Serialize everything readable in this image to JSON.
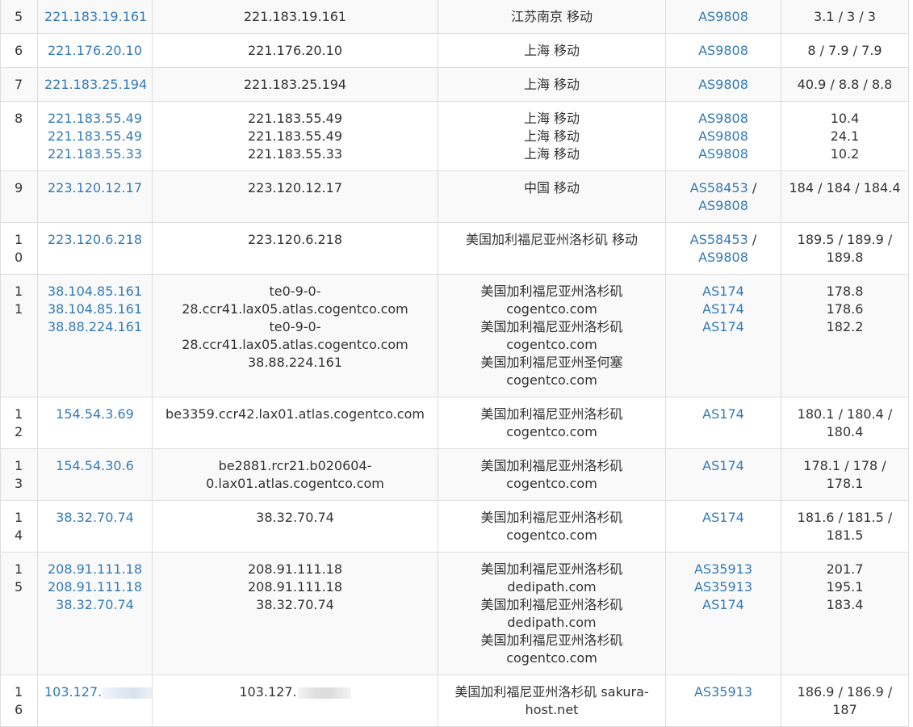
{
  "rows": [
    {
      "hop": "5",
      "ips": [
        "221.183.19.161"
      ],
      "hosts": [
        "221.183.19.161"
      ],
      "locs": [
        "江苏南京 移动"
      ],
      "as": [
        "AS9808"
      ],
      "rtt": "3.1 / 3 / 3"
    },
    {
      "hop": "6",
      "ips": [
        "221.176.20.10"
      ],
      "hosts": [
        "221.176.20.10"
      ],
      "locs": [
        "上海 移动"
      ],
      "as": [
        "AS9808"
      ],
      "rtt": "8 / 7.9 / 7.9"
    },
    {
      "hop": "7",
      "ips": [
        "221.183.25.194"
      ],
      "hosts": [
        "221.183.25.194"
      ],
      "locs": [
        "上海 移动"
      ],
      "as": [
        "AS9808"
      ],
      "rtt": "40.9 / 8.8 / 8.8"
    },
    {
      "hop": "8",
      "ips": [
        "221.183.55.49",
        "221.183.55.49",
        "221.183.55.33"
      ],
      "hosts": [
        "221.183.55.49",
        "221.183.55.49",
        "221.183.55.33"
      ],
      "locs": [
        "上海 移动",
        "上海 移动",
        "上海 移动"
      ],
      "as": [
        "AS9808",
        "AS9808",
        "AS9808"
      ],
      "rtt_lines": [
        "10.4",
        "24.1",
        "10.2"
      ]
    },
    {
      "hop": "9",
      "ips": [
        "223.120.12.17"
      ],
      "hosts": [
        "223.120.12.17"
      ],
      "locs": [
        "中国 移动"
      ],
      "as_pair": [
        "AS58453",
        "AS9808"
      ],
      "rtt": "184 / 184 / 184.4"
    },
    {
      "hop": "10",
      "ips": [
        "223.120.6.218"
      ],
      "hosts": [
        "223.120.6.218"
      ],
      "locs": [
        "美国加利福尼亚州洛杉矶 移动"
      ],
      "as_pair": [
        "AS58453",
        "AS9808"
      ],
      "rtt": "189.5 / 189.9 / 189.8"
    },
    {
      "hop": "11",
      "ips": [
        "38.104.85.161",
        "38.104.85.161",
        "38.88.224.161"
      ],
      "hosts": [
        "te0-9-0-28.ccr41.lax05.atlas.cogentco.com",
        "te0-9-0-28.ccr41.lax05.atlas.cogentco.com",
        "38.88.224.161"
      ],
      "locs": [
        "美国加利福尼亚州洛杉矶",
        "cogentco.com",
        "美国加利福尼亚州洛杉矶",
        "cogentco.com",
        "美国加利福尼亚州圣何塞",
        "cogentco.com"
      ],
      "as": [
        "AS174",
        "AS174",
        "AS174"
      ],
      "rtt_lines": [
        "178.8",
        "178.6",
        "182.2"
      ]
    },
    {
      "hop": "12",
      "ips": [
        "154.54.3.69"
      ],
      "hosts": [
        "be3359.ccr42.lax01.atlas.cogentco.com"
      ],
      "locs": [
        "美国加利福尼亚州洛杉矶",
        "cogentco.com"
      ],
      "as": [
        "AS174"
      ],
      "rtt": "180.1 / 180.4 / 180.4"
    },
    {
      "hop": "13",
      "ips": [
        "154.54.30.6"
      ],
      "hosts": [
        "be2881.rcr21.b020604-0.lax01.atlas.cogentco.com"
      ],
      "locs": [
        "美国加利福尼亚州洛杉矶",
        "cogentco.com"
      ],
      "as": [
        "AS174"
      ],
      "rtt": "178.1 / 178 / 178.1"
    },
    {
      "hop": "14",
      "ips": [
        "38.32.70.74"
      ],
      "hosts": [
        "38.32.70.74"
      ],
      "locs": [
        "美国加利福尼亚州洛杉矶",
        "cogentco.com"
      ],
      "as": [
        "AS174"
      ],
      "rtt": "181.6 / 181.5 / 181.5"
    },
    {
      "hop": "15",
      "ips": [
        "208.91.111.18",
        "208.91.111.18",
        "38.32.70.74"
      ],
      "hosts": [
        "208.91.111.18",
        "208.91.111.18",
        "38.32.70.74"
      ],
      "locs": [
        "美国加利福尼亚州洛杉矶",
        "dedipath.com",
        "美国加利福尼亚州洛杉矶",
        "dedipath.com",
        "美国加利福尼亚州洛杉矶",
        "cogentco.com"
      ],
      "as": [
        "AS35913",
        "AS35913",
        "AS174"
      ],
      "rtt_lines": [
        "201.7",
        "195.1",
        "183.4"
      ]
    },
    {
      "hop": "16",
      "ips": [
        "103.127."
      ],
      "hosts": [
        "103.127."
      ],
      "locs": [
        "美国加利福尼亚州洛杉矶 sakura-host.net"
      ],
      "as": [
        "AS35913"
      ],
      "rtt": "186.9 / 186.9 / 187",
      "redacted": true
    }
  ],
  "colors": {
    "link": "#337ab7",
    "text": "#333333",
    "border": "#dddddd",
    "stripe": "#f9f9f9"
  }
}
